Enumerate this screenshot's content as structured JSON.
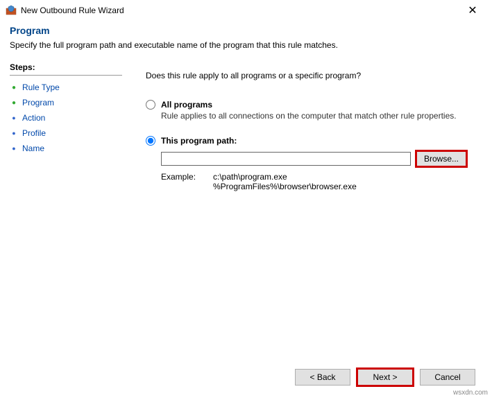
{
  "window": {
    "title": "New Outbound Rule Wizard",
    "close": "✕"
  },
  "header": {
    "title": "Program",
    "description": "Specify the full program path and executable name of the program that this rule matches."
  },
  "sidebar": {
    "heading": "Steps:",
    "items": [
      {
        "label": "Rule Type",
        "state": "done"
      },
      {
        "label": "Program",
        "state": "current"
      },
      {
        "label": "Action",
        "state": "pending"
      },
      {
        "label": "Profile",
        "state": "pending"
      },
      {
        "label": "Name",
        "state": "pending"
      }
    ]
  },
  "main": {
    "question": "Does this rule apply to all programs or a specific program?",
    "all_programs": {
      "label": "All programs",
      "desc": "Rule applies to all connections on the computer that match other rule properties."
    },
    "this_path": {
      "label": "This program path:",
      "value": "",
      "browse": "Browse...",
      "example_label": "Example:",
      "example_text": "c:\\path\\program.exe\n%ProgramFiles%\\browser\\browser.exe"
    }
  },
  "footer": {
    "back": "< Back",
    "next": "Next >",
    "cancel": "Cancel"
  },
  "watermark": "wsxdn.com"
}
